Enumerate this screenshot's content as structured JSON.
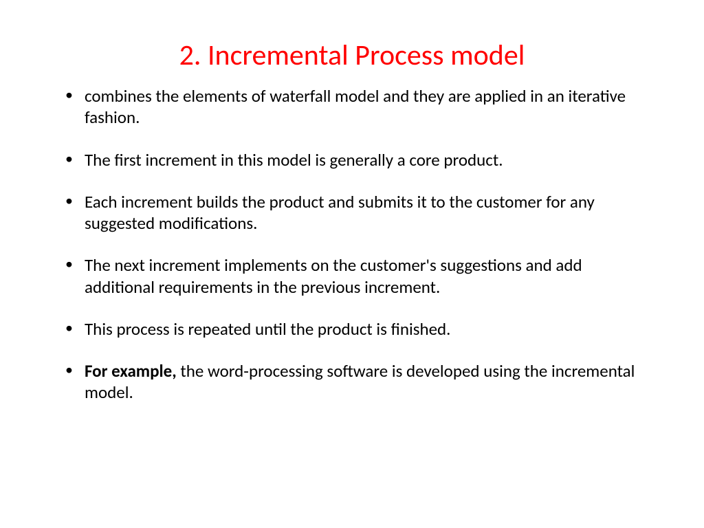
{
  "slide": {
    "title": "2. Incremental Process model",
    "bullets": [
      {
        "text": "combines the elements of waterfall model and they are applied in an iterative fashion.",
        "bold_prefix": ""
      },
      {
        "text": "The first increment in this model is generally a core product.",
        "bold_prefix": ""
      },
      {
        "text": "Each increment builds the product and submits it to the customer for any suggested modifications.",
        "bold_prefix": ""
      },
      {
        "text": "The next increment implements on the customer's suggestions and add additional requirements in the previous increment.",
        "bold_prefix": ""
      },
      {
        "text": "This process is repeated until the product is finished.",
        "bold_prefix": ""
      },
      {
        "text": "the word-processing software is developed using the incremental model.",
        "bold_prefix": "For example, "
      }
    ]
  }
}
